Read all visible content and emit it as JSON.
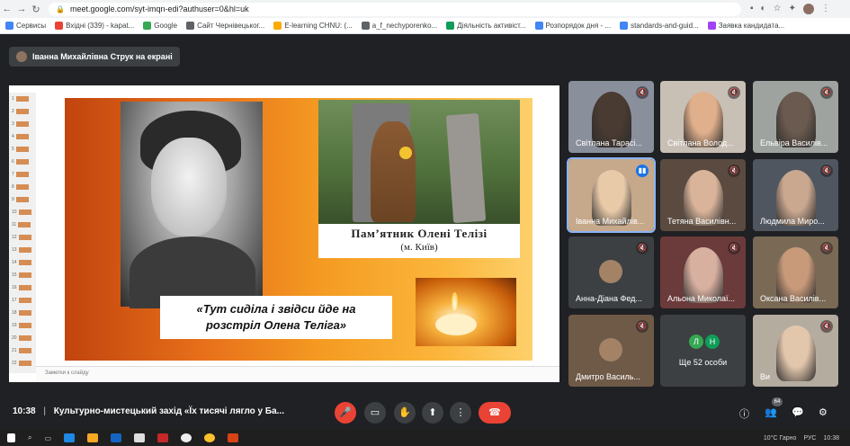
{
  "browser": {
    "url": "meet.google.com/syt-imqn-edi?authuser=0&hl=uk"
  },
  "bookmarks": [
    {
      "label": "Сервисы",
      "color": "#4285f4"
    },
    {
      "label": "Вхідні (339) - kapat...",
      "color": "#ea4335"
    },
    {
      "label": "Google",
      "color": "#34a853"
    },
    {
      "label": "Сайт Чернівецьког...",
      "color": "#5f6368"
    },
    {
      "label": "E-learning CHNU: (...",
      "color": "#f9ab00"
    },
    {
      "label": "a_f_nechyporenko...",
      "color": "#5f6368"
    },
    {
      "label": "Діяльність активіст...",
      "color": "#0f9d58"
    },
    {
      "label": "Розпорядок дня - ...",
      "color": "#4285f4"
    },
    {
      "label": "standards-and-guid...",
      "color": "#4285f4"
    },
    {
      "label": "Заявка кандидата...",
      "color": "#a142f4"
    }
  ],
  "presenting": {
    "label": "Іванна Михайлівна Струк на екрані"
  },
  "slide": {
    "caption_line1": "Пам’ятник Олені Телізі",
    "caption_line2": "(м. Київ)",
    "quote_line1": "«Тут сиділа і звідси йде на",
    "quote_line2": "розстріл Олена Теліга»",
    "notes_placeholder": "Заметки к слайду"
  },
  "thumbnails": [
    "1",
    "2",
    "3",
    "4",
    "5",
    "6",
    "7",
    "8",
    "9",
    "10",
    "11",
    "12",
    "13",
    "14",
    "15",
    "16",
    "17",
    "18",
    "19",
    "20",
    "21",
    "22"
  ],
  "participants": [
    {
      "name": "Світлана Тарасі...",
      "bg": "#8a8f9c",
      "person": "#4a3b32",
      "mic": "muted"
    },
    {
      "name": "Світлана Волод...",
      "bg": "#c9c0b5",
      "person": "#e0b08c",
      "mic": "muted"
    },
    {
      "name": "Ельвіра Василів...",
      "bg": "#9ea3a0",
      "person": "#6b5a4f",
      "mic": "muted"
    },
    {
      "name": "Іванна Михайлів...",
      "bg": "#c6a88a",
      "person": "#e8c9a8",
      "mic": "speaking"
    },
    {
      "name": "Тетяна Василівн...",
      "bg": "#5a4a40",
      "person": "#d9b49a",
      "mic": "muted"
    },
    {
      "name": "Людмила Миро...",
      "bg": "#4f5660",
      "person": "#caa890",
      "mic": "muted"
    },
    {
      "name": "Анна-Діана Фед...",
      "bg": "#3c4043",
      "person": "",
      "mic": "muted"
    },
    {
      "name": "Альона Миколаї...",
      "bg": "#6b3a3a",
      "person": "#d8b0a0",
      "mic": "muted"
    },
    {
      "name": "Оксана Василів...",
      "bg": "#7a6a55",
      "person": "#c89a7a",
      "mic": "muted"
    },
    {
      "name": "Дмитро Василь...",
      "bg": "#6f5a48",
      "person": "",
      "mic": "muted"
    },
    {
      "name": "",
      "bg": "#3c4043",
      "person": "",
      "mic": "none"
    },
    {
      "name": "Ви",
      "bg": "#b5aca0",
      "person": "#e3c7ad",
      "mic": "muted"
    }
  ],
  "more": {
    "avatar1": "Л",
    "avatar2": "Н",
    "label": "Ще 52 особи"
  },
  "meeting": {
    "time": "10:38",
    "separator": "|",
    "title": "Культурно-мистецький захід «Їх тисячі лягло у Ба..."
  },
  "controls": {
    "mic_icon": "🎤",
    "camera_icon": "▭",
    "hand_icon": "✋",
    "present_icon": "⬆",
    "more_icon": "⋮",
    "hangup_icon": "☎"
  },
  "right_controls": {
    "info_icon": "ⓘ",
    "people_icon": "👥",
    "people_count": "64",
    "chat_icon": "💬",
    "activities_icon": "⚙"
  },
  "taskbar": {
    "weather": "10°C  Гарно",
    "lang": "РУС",
    "clock": "10:38"
  },
  "colors": {
    "accent_red": "#ea4335",
    "speaking_blue": "#1a73e8",
    "meet_bg": "#202124"
  }
}
